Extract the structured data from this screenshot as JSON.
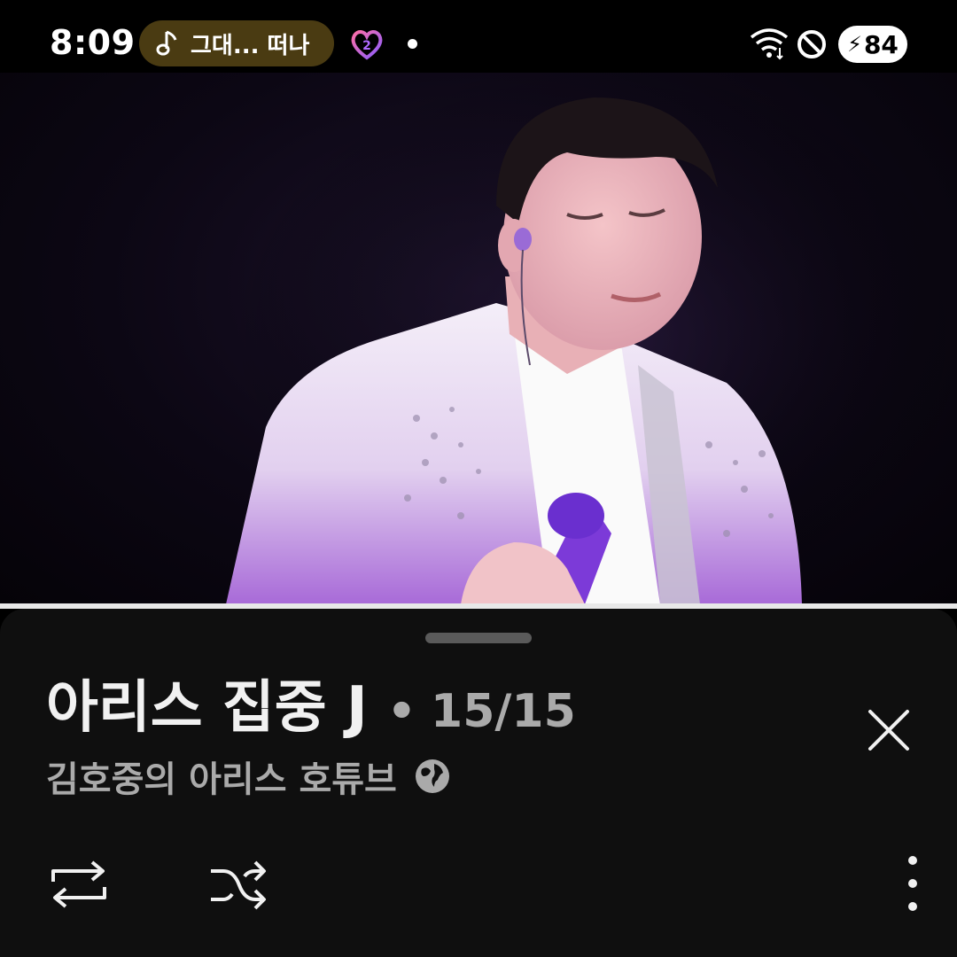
{
  "status_bar": {
    "time": "8:09",
    "now_playing": "그대... 떠나",
    "battery": "84",
    "icons": [
      "music-note-icon",
      "app-heart-icon",
      "notification-dot",
      "wifi-icon",
      "do-not-disturb-icon",
      "charging-bolt-icon"
    ]
  },
  "video": {
    "description_icon": "concert-performance-frame"
  },
  "playlist": {
    "title": "아리스 집중 J",
    "separator": "•",
    "position": "15/15",
    "channel": "김호중의 아리스 호튜브",
    "visibility_icon": "globe-icon"
  },
  "controls": {
    "loop_icon": "repeat-icon",
    "shuffle_icon": "shuffle-icon",
    "more_icon": "more-vertical-icon",
    "close_icon": "close-icon"
  },
  "colors": {
    "accent_pill": "#4a3b12",
    "sheet_bg": "#0f0f0f",
    "text_primary": "#f1f1f1",
    "text_secondary": "#aaaaaa"
  }
}
